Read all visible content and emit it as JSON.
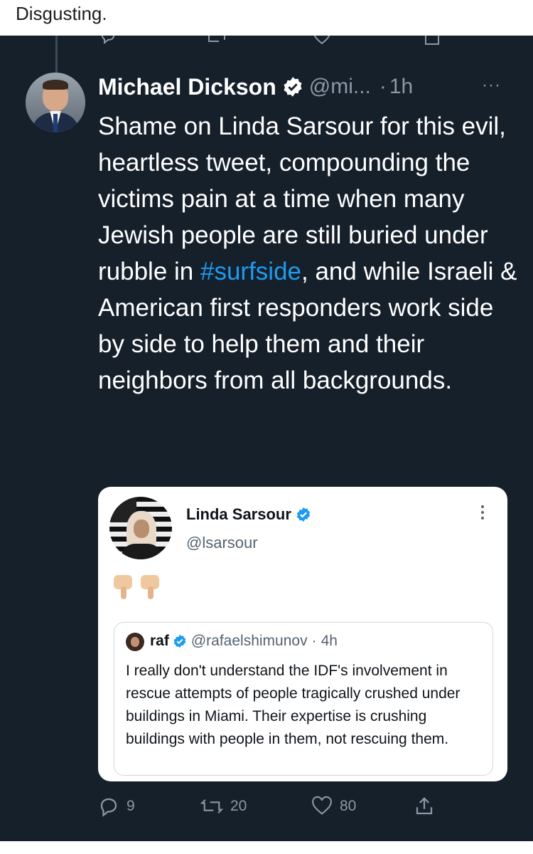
{
  "caption": "Disgusting.",
  "tweet": {
    "author_name": "Michael Dickson",
    "author_handle": "@mi...",
    "time_separator": "·",
    "time": "1h",
    "more_label": "···",
    "text_part1": "Shame on Linda Sarsour for this evil, heartless tweet, compounding the victims pain at a time when many Jewish people are still buried under rubble in ",
    "hashtag": "#surfside",
    "text_part2": ", and while Israeli & American first responders work side by side to help them and their neighbors from all backgrounds."
  },
  "quoted_tweet": {
    "author_name": "Linda Sarsour",
    "author_handle": "@lsarsour",
    "more_label": "⋮",
    "emoji_names": [
      "thumbs-down-emoji",
      "thumbs-down-emoji"
    ],
    "nested": {
      "author_name": "raf",
      "author_handle": "@rafaelshimunov",
      "time_separator": "·",
      "time": "4h",
      "text": "I really don't understand the IDF's involvement in rescue attempts of people tragically crushed under buildings in Miami. Their expertise is crushing buildings with people in them, not rescuing them."
    }
  },
  "actions": {
    "reply_count": "9",
    "retweet_count": "20",
    "like_count": "80"
  },
  "icons": {
    "reply": "reply-icon",
    "retweet": "retweet-icon",
    "like": "heart-icon",
    "share": "share-icon",
    "verified": "verified-badge-icon"
  },
  "colors": {
    "background": "#16202b",
    "accent": "#1d9bf0",
    "secondary_text": "#8b98a5"
  }
}
